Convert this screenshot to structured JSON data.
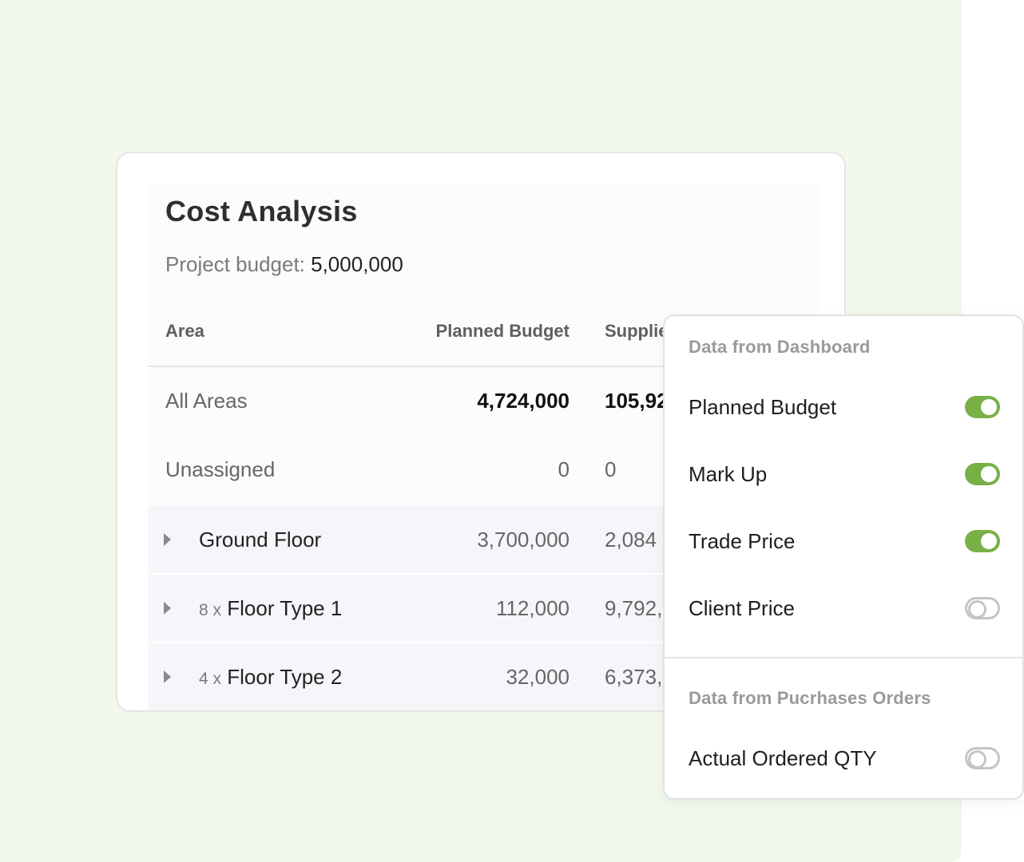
{
  "card": {
    "title": "Cost Analysis",
    "budget_label": "Project budget:",
    "budget_value": "5,000,000",
    "columns": {
      "area": "Area",
      "planned": "Planned Budget",
      "supplier": "Supplie"
    },
    "rows": [
      {
        "name": "All Areas",
        "planned": "4,724,000",
        "supplier": "105,92"
      },
      {
        "name": "Unassigned",
        "planned": "0",
        "supplier": "0"
      },
      {
        "name": "Ground Floor",
        "planned": "3,700,000",
        "supplier": "2,084"
      },
      {
        "mult": "8 x",
        "name": "Floor Type 1",
        "planned": "112,000",
        "supplier": "9,792,"
      },
      {
        "mult": "4 x",
        "name": "Floor Type 2",
        "planned": "32,000",
        "supplier": "6,373,"
      }
    ]
  },
  "popup": {
    "section1": "Data from Dashboard",
    "section2": "Data from Pucrhases Orders",
    "options": [
      {
        "label": "Planned Budget",
        "enabled": true
      },
      {
        "label": "Mark Up",
        "enabled": true
      },
      {
        "label": "Trade Price",
        "enabled": true
      },
      {
        "label": "Client Price",
        "enabled": false
      },
      {
        "label": "Actual Ordered QTY",
        "enabled": false
      }
    ]
  },
  "colors": {
    "background": "#f2f8ec",
    "toggle_on": "#78b046",
    "toggle_off": "#c4c4c4"
  }
}
